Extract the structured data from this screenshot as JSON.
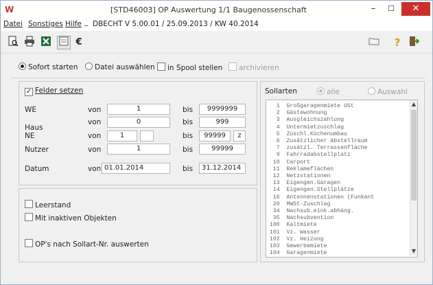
{
  "window": {
    "app_letter": "W",
    "title": "[STD46003] OP Auswertung  1/1 Baugenossenschaft",
    "min_label": "–",
    "max_label": "☐",
    "close_label": "✕"
  },
  "menu": {
    "datei": "Datei",
    "sonstiges": "Sonstiges",
    "hilfe": "Hilfe",
    "dot": "_",
    "version": "DBECHT V 5.00.01  /  25.09.2013 / KW 40.2014"
  },
  "toolbar": {
    "euro": "€"
  },
  "options": {
    "sofort": "Sofort starten",
    "datei": "Datei auswählen",
    "spool": "in Spool stellen",
    "archiv": "archivieren"
  },
  "felder": {
    "label": "Felder setzen",
    "rows": [
      {
        "label": "WE",
        "von": "von",
        "from": "1",
        "bis": "bis",
        "to": "9999999"
      },
      {
        "label": "Haus",
        "von": "von",
        "from": "0",
        "bis": "bis",
        "to": "999"
      },
      {
        "label": "NE",
        "von": "von",
        "from": "1",
        "bis": "bis",
        "to": "99999",
        "z": "z"
      },
      {
        "label": "Nutzer",
        "von": "von",
        "from": "1",
        "bis": "bis",
        "to": "99999"
      },
      {
        "label": "Datum",
        "von": "von",
        "from": "01.01.2014",
        "bis": "bis",
        "to": "31.12.2014"
      }
    ]
  },
  "lower": {
    "leerstand": "Leerstand",
    "inaktiv": "Mit inaktiven Objekten",
    "sollart_nr": "OP's nach Sollart-Nr. auswerten"
  },
  "sollarten": {
    "title": "Sollarten",
    "alle": "alle",
    "auswahl": "Auswahl",
    "items": [
      "   1  Großgaragenmiete USt",
      "   2  Gästewohnung",
      "   3  Ausgleichszahlung",
      "   4  Untermietzuschlag",
      "   5  Zuschl.Küchenumbau",
      "   6  Zusätzlicher Abstellraum",
      "   7  zusätzl. Terrassenfläche",
      "   9  Fahrradabstellplatz",
      "  10  Carport",
      "  11  Reklameflächen",
      "  12  Netzstationen",
      "  13  Eigengen.Garagen",
      "  14  Eigengen.Stellplätze",
      "  16  Antennenstationen (Funkant",
      "  20  MWSt-Zuschlag",
      "  34  Nachsub.eink.abhäng.",
      "  35  Nachsubvention",
      " 100  Kaltmiete",
      " 101  Vz. Wasser",
      " 102  Vz. Heizung",
      " 103  Gewerbemiete",
      " 104  Garagenmiete"
    ]
  }
}
